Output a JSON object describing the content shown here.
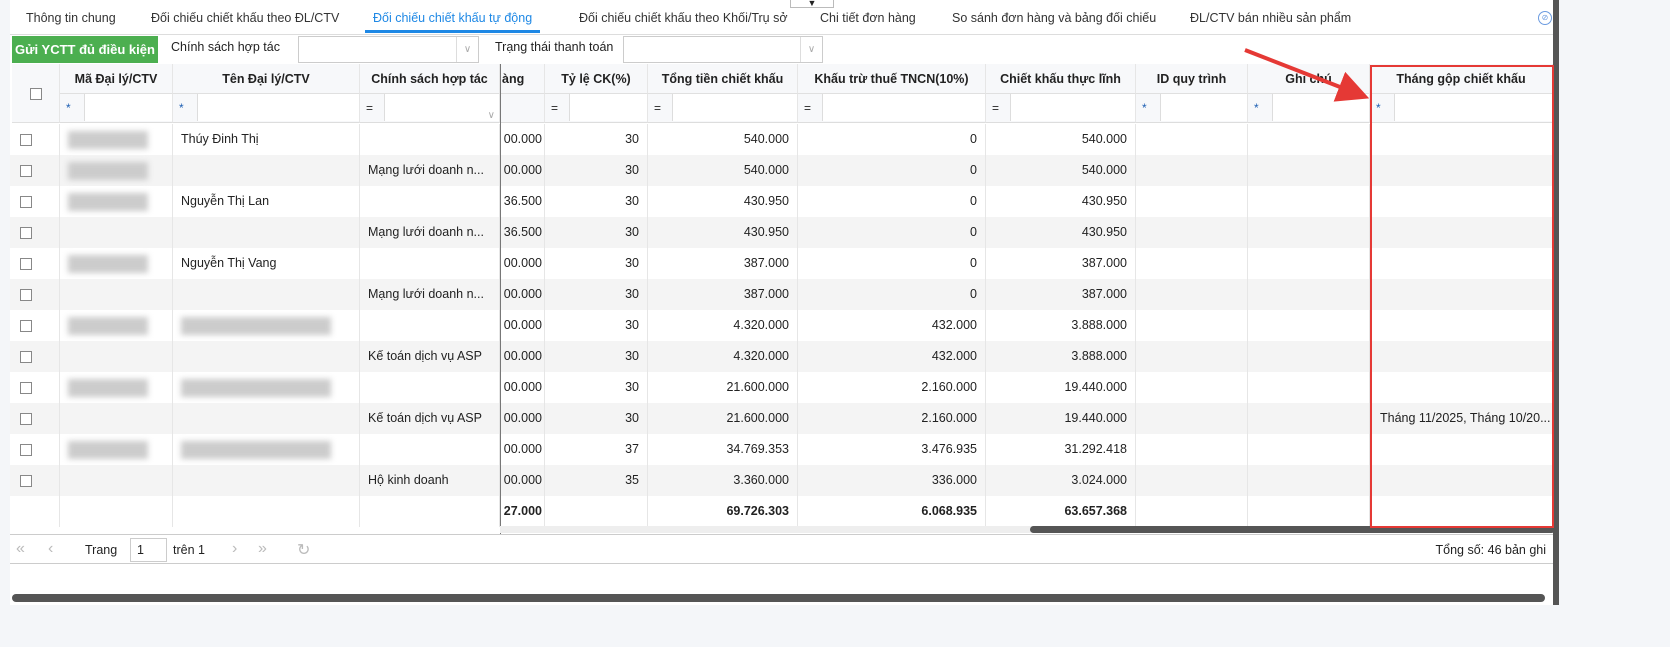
{
  "tabs": [
    {
      "label": "Thông tin chung"
    },
    {
      "label": "Đối chiếu chiết khấu theo ĐL/CTV"
    },
    {
      "label": "Đối chiếu chiết khấu tự động",
      "active": true
    },
    {
      "label": "Đối chiếu chiết khấu theo Khối/Trụ sở"
    },
    {
      "label": "Chi tiết đơn hàng"
    },
    {
      "label": "So sánh đơn hàng và bảng đối chiếu"
    },
    {
      "label": "ĐL/CTV bán nhiều sản phẩm"
    }
  ],
  "toolbar": {
    "send_button": "Gửi YCTT đủ điều kiện",
    "policy_label": "Chính sách hợp tác",
    "policy_value": "",
    "payment_label": "Trạng thái thanh toán",
    "payment_value": ""
  },
  "columns": [
    {
      "label": "Mã Đại lý/CTV",
      "op": "*"
    },
    {
      "label": "Tên Đại lý/CTV",
      "op": "*"
    },
    {
      "label": "Chính sách hợp tác",
      "op": "="
    },
    {
      "label": "àng",
      "op": ""
    },
    {
      "label": "Tỷ lệ CK(%)",
      "op": "="
    },
    {
      "label": "Tổng tiền chiết khấu",
      "op": "="
    },
    {
      "label": "Khấu trừ thuế TNCN(10%)",
      "op": "="
    },
    {
      "label": "Chiết khấu thực lĩnh",
      "op": "="
    },
    {
      "label": "ID quy trình",
      "op": "*"
    },
    {
      "label": "Ghi chú",
      "op": "*"
    },
    {
      "label": "Tháng gộp chiết khấu",
      "op": "*"
    }
  ],
  "rows": [
    {
      "code_blur": true,
      "name": "Thúy Đinh Thị",
      "policy": "",
      "amt": "00.000",
      "rate": "30",
      "total": "540.000",
      "tax": "0",
      "net": "540.000",
      "month": ""
    },
    {
      "code_blur": true,
      "name": "",
      "policy": "Mạng lưới doanh n...",
      "amt": "00.000",
      "rate": "30",
      "total": "540.000",
      "tax": "0",
      "net": "540.000",
      "month": ""
    },
    {
      "code_blur": true,
      "name": "Nguyễn Thị Lan",
      "policy": "",
      "amt": "36.500",
      "rate": "30",
      "total": "430.950",
      "tax": "0",
      "net": "430.950",
      "month": ""
    },
    {
      "code_blur": false,
      "name": "",
      "policy": "Mạng lưới doanh n...",
      "amt": "36.500",
      "rate": "30",
      "total": "430.950",
      "tax": "0",
      "net": "430.950",
      "month": ""
    },
    {
      "code_blur": true,
      "name": "Nguyễn Thị Vang",
      "policy": "",
      "amt": "00.000",
      "rate": "30",
      "total": "387.000",
      "tax": "0",
      "net": "387.000",
      "month": ""
    },
    {
      "code_blur": false,
      "name": "",
      "policy": "Mạng lưới doanh n...",
      "amt": "00.000",
      "rate": "30",
      "total": "387.000",
      "tax": "0",
      "net": "387.000",
      "month": ""
    },
    {
      "code_blur": true,
      "name_blur": true,
      "name": "",
      "policy": "",
      "amt": "00.000",
      "rate": "30",
      "total": "4.320.000",
      "tax": "432.000",
      "net": "3.888.000",
      "month": ""
    },
    {
      "code_blur": false,
      "name": "",
      "policy": "Kế toán dịch vụ ASP",
      "amt": "00.000",
      "rate": "30",
      "total": "4.320.000",
      "tax": "432.000",
      "net": "3.888.000",
      "month": ""
    },
    {
      "code_blur": true,
      "name_blur": true,
      "name": "",
      "policy": "",
      "amt": "00.000",
      "rate": "30",
      "total": "21.600.000",
      "tax": "2.160.000",
      "net": "19.440.000",
      "month": ""
    },
    {
      "code_blur": false,
      "name": "",
      "policy": "Kế toán dịch vụ ASP",
      "amt": "00.000",
      "rate": "30",
      "total": "21.600.000",
      "tax": "2.160.000",
      "net": "19.440.000",
      "month": "Tháng 11/2025, Tháng 10/20..."
    },
    {
      "code_blur": true,
      "name_blur": true,
      "name": "",
      "policy": "",
      "amt": "00.000",
      "rate": "37",
      "total": "34.769.353",
      "tax": "3.476.935",
      "net": "31.292.418",
      "month": ""
    },
    {
      "code_blur": false,
      "name": "",
      "policy": "Hộ kinh doanh",
      "amt": "00.000",
      "rate": "35",
      "total": "3.360.000",
      "tax": "336.000",
      "net": "3.024.000",
      "month": ""
    }
  ],
  "totals": {
    "amt": "27.000",
    "total": "69.726.303",
    "tax": "6.068.935",
    "net": "63.657.368"
  },
  "pager": {
    "page_label": "Trang",
    "page": "1",
    "of_label": "trên 1",
    "total_label": "Tổng số: 46 bản ghi"
  },
  "colors": {
    "accent": "#1e88e5",
    "green": "#4caf50",
    "highlight": "#e53935"
  }
}
